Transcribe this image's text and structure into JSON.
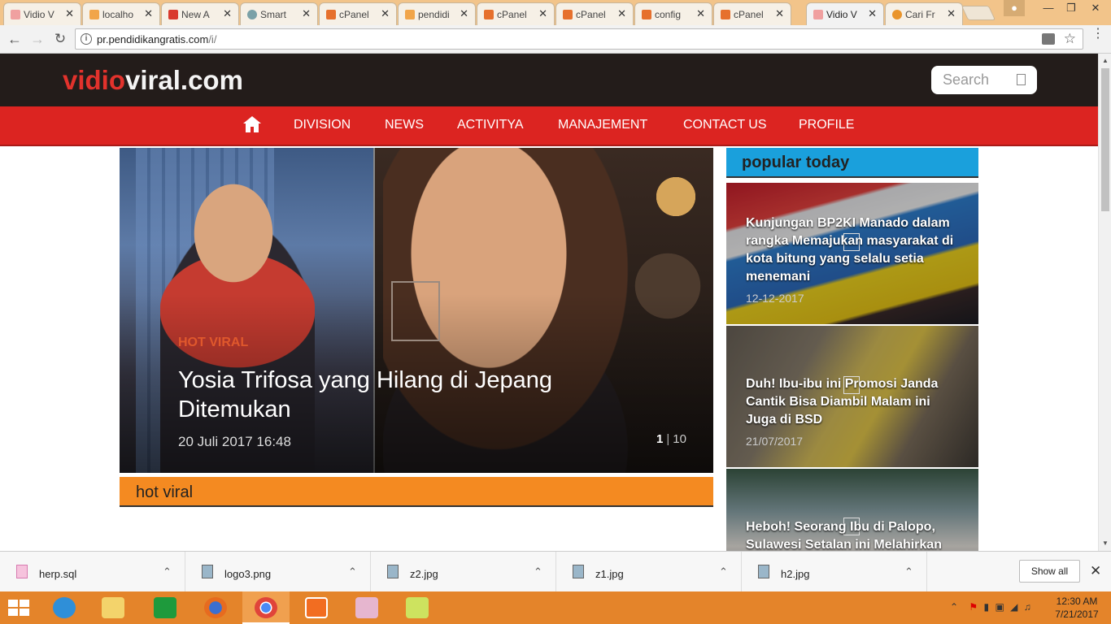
{
  "browser": {
    "tabs": [
      {
        "title": "Vidio V",
        "favicon_color": "#f0a0a0"
      },
      {
        "title": "localho",
        "favicon_color": "#f1a54a"
      },
      {
        "title": "New A",
        "favicon_color": "#d93a2e"
      },
      {
        "title": "Smart",
        "favicon_color": "#7aa1a8"
      },
      {
        "title": "cPanel",
        "favicon_color": "#e6702d"
      },
      {
        "title": "pendidi",
        "favicon_color": "#f1a54a"
      },
      {
        "title": "cPanel",
        "favicon_color": "#e6702d"
      },
      {
        "title": "cPanel",
        "favicon_color": "#e6702d"
      },
      {
        "title": "config",
        "favicon_color": "#e6702d"
      },
      {
        "title": "cPanel",
        "favicon_color": "#e6702d"
      },
      {
        "title": "Vidio V",
        "favicon_color": "#f0a0a0"
      },
      {
        "title": "Cari Fr",
        "favicon_color": "#e9942b"
      }
    ],
    "tab_close_glyph": "✕",
    "url_host": "pr.pendidikangratis.com",
    "url_path": "/i/"
  },
  "site": {
    "logo_part1": "vidio",
    "logo_part2": "viral.com",
    "search_placeholder": "Search",
    "nav": [
      "DIVISION",
      "NEWS",
      "ACTIVITYA",
      "MANAJEMENT",
      "CONTACT US",
      "PROFILE"
    ]
  },
  "hero": {
    "category": "HOT VIRAL",
    "title": "Yosia Trifosa yang Hilang di Jepang Ditemukan",
    "date": "20 Juli 2017 16:48",
    "page_current": "1",
    "page_sep": "|",
    "page_total": "10"
  },
  "section": {
    "label": "hot viral"
  },
  "sidebar": {
    "heading": "popular today",
    "items": [
      {
        "title": "Kunjungan BP2KI Manado dalam rangka Memajukan masyarakat di kota bitung yang selalu setia menemani",
        "date": "12-12-2017"
      },
      {
        "title": "Duh! Ibu-ibu ini Promosi Janda Cantik Bisa Diambil Malam ini Juga di BSD",
        "date": "21/07/2017"
      },
      {
        "title": "Heboh! Seorang Ibu di Palopo, Sulawesi Setalan ini Melahirkan",
        "date": ""
      }
    ]
  },
  "downloads": {
    "items": [
      "herp.sql",
      "logo3.png",
      "z2.jpg",
      "z1.jpg",
      "h2.jpg"
    ],
    "show_all": "Show all"
  },
  "taskbar": {
    "time": "12:30 AM",
    "date": "7/21/2017"
  },
  "colors": {
    "header_bg": "#231c1a",
    "nav_bg": "#dc2421",
    "section_orange": "#f48a21",
    "sidebar_blue": "#1aa0dc",
    "taskbar": "#e4842a"
  }
}
